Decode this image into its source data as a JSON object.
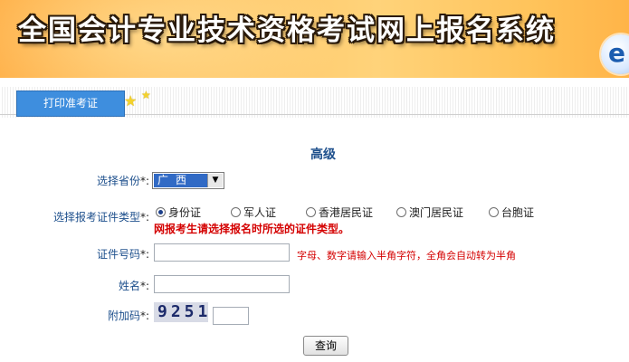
{
  "banner": {
    "title": "全国会计专业技术资格考试网上报名系统",
    "logo_letter": "e"
  },
  "tab": {
    "print_label": "打印准考证"
  },
  "form": {
    "level_title": "高级",
    "province_label": "选择省份",
    "province_value": "广西",
    "idtype_label": "选择报考证件类型",
    "required_mark": "*:",
    "idtypes": [
      "身份证",
      "军人证",
      "香港居民证",
      "澳门居民证",
      "台胞证"
    ],
    "idtype_selected": "身份证",
    "idtype_warning": "网报考生请选择报名时所选的证件类型。",
    "idnumber_label": "证件号码",
    "idnumber_hint": "字母、数字请输入半角字符，全角会自动转为半角",
    "name_label": "姓名",
    "captcha_label": "附加码",
    "captcha_value": "9251",
    "query_button": "查询"
  },
  "colors": {
    "label_blue": "#1d4f8c",
    "warning_red": "#d40000",
    "tab_blue": "#3e8ede"
  }
}
